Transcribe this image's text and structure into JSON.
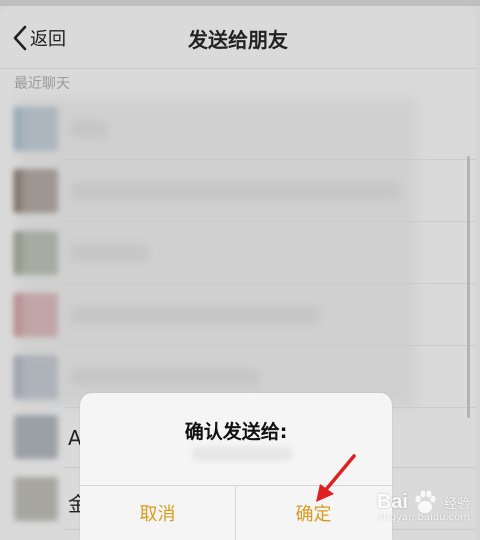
{
  "header": {
    "back_label": "返回",
    "title": "发送给朋友"
  },
  "recent": {
    "section_label": "最近聊天",
    "rows": [
      {
        "avatar_color": "#8aa0b4",
        "name_width": 38
      },
      {
        "avatar_color": "#6b5a4e",
        "name_width": 330
      },
      {
        "avatar_color": "#7d8a76",
        "name_width": 78
      },
      {
        "avatar_color": "#b87b7e",
        "name_width": 250
      },
      {
        "avatar_color": "#8f99a8",
        "name_width": 190
      }
    ]
  },
  "contacts": [
    {
      "initial": "A",
      "avatar_color": "#9aa0a6"
    },
    {
      "initial": "金",
      "avatar_color": "#a7a7a0"
    }
  ],
  "dialog": {
    "title": "确认发送给:",
    "cancel_label": "取消",
    "confirm_label": "确定"
  },
  "watermark": {
    "brand_left": "Bai",
    "brand_right": "经验",
    "url": "jingyan.baidu.com"
  },
  "colors": {
    "accent": "#d79c1e",
    "arrow": "#e02020"
  }
}
